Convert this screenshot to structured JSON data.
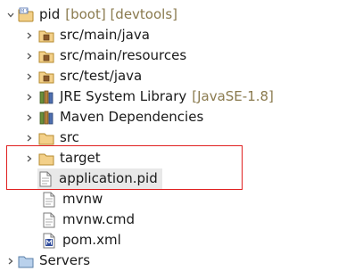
{
  "project": {
    "name": "pid",
    "decoration": "[boot] [devtools]"
  },
  "items": [
    {
      "label": "src/main/java",
      "icon": "source-folder-icon"
    },
    {
      "label": "src/main/resources",
      "icon": "source-folder-icon"
    },
    {
      "label": "src/test/java",
      "icon": "source-folder-icon"
    },
    {
      "label": "JRE System Library",
      "decoration": "[JavaSE-1.8]",
      "icon": "library-icon"
    },
    {
      "label": "Maven Dependencies",
      "icon": "library-icon"
    },
    {
      "label": "src",
      "icon": "folder-icon"
    },
    {
      "label": "target",
      "icon": "folder-icon"
    },
    {
      "label": "application.pid",
      "icon": "file-icon"
    },
    {
      "label": "mvnw",
      "icon": "file-icon"
    },
    {
      "label": "mvnw.cmd",
      "icon": "file-icon"
    },
    {
      "label": "pom.xml",
      "icon": "maven-file-icon"
    }
  ],
  "servers": {
    "label": "Servers"
  },
  "colors": {
    "highlight_border": "#e02020",
    "decoration": "#8a7a4e",
    "selection": "#e8e8e8"
  }
}
